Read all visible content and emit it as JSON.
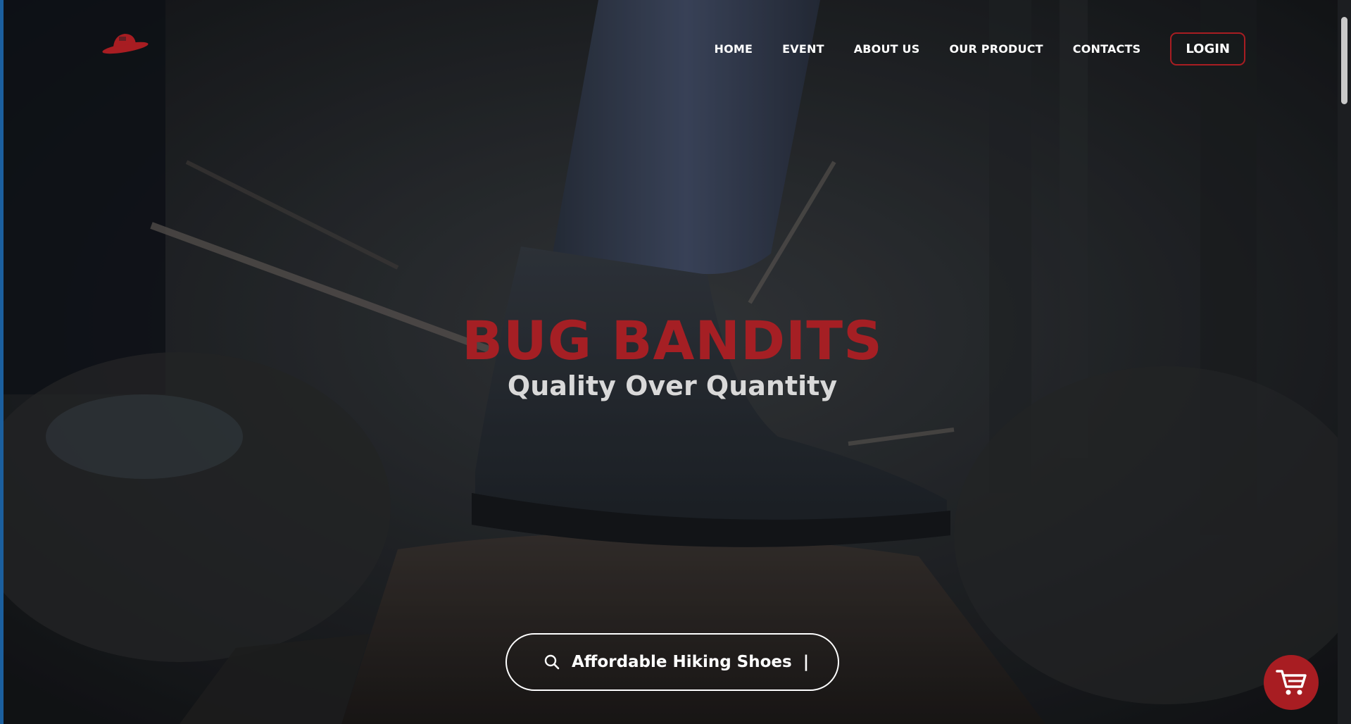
{
  "brand": {
    "logo_icon": "hat-icon",
    "accent_color": "#a81d22"
  },
  "nav": {
    "links": [
      "HOME",
      "EVENT",
      "ABOUT US",
      "OUR PRODUCT",
      "CONTACTS"
    ],
    "login_label": "LOGIN"
  },
  "hero": {
    "title": "BUG BANDITS",
    "subtitle": "Quality Over Quantity",
    "title_color": "#a51f24"
  },
  "search": {
    "icon": "search-icon",
    "typed_text": "Affordable Hiking Shoes",
    "caret": "|"
  },
  "cart": {
    "icon": "cart-icon"
  }
}
